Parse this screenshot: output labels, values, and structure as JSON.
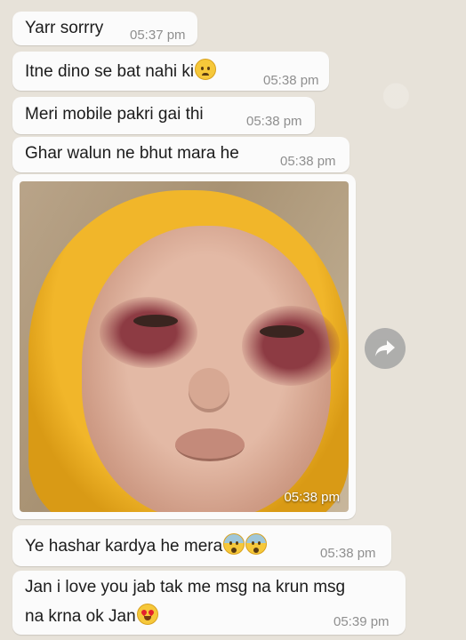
{
  "messages": [
    {
      "text": "Yarr sorrry",
      "time": "05:37 pm"
    },
    {
      "text": "Itne dino se bat nahi ki",
      "emoji": "sad-face",
      "time": "05:38 pm"
    },
    {
      "text": "Meri mobile pakri gai thi",
      "time": "05:38 pm"
    },
    {
      "text": "Ghar walun ne bhut mara he",
      "time": "05:38 pm"
    },
    {
      "type": "photo",
      "time": "05:38 pm"
    },
    {
      "text": "Ye hashar kardya he mera",
      "emoji": "fearful-face x2",
      "time": "05:38 pm"
    },
    {
      "text_line1": "Jan i love you jab tak me msg na krun msg",
      "text_line2": "na krna ok Jan",
      "emoji": "heart-eyes-face",
      "time": "05:39 pm"
    }
  ],
  "icons": {
    "forward": "forward-arrow-icon"
  },
  "colors": {
    "bubble": "#fbfbfb",
    "wallpaper": "#e7e2d9",
    "timestamp": "#8f8f8f"
  }
}
